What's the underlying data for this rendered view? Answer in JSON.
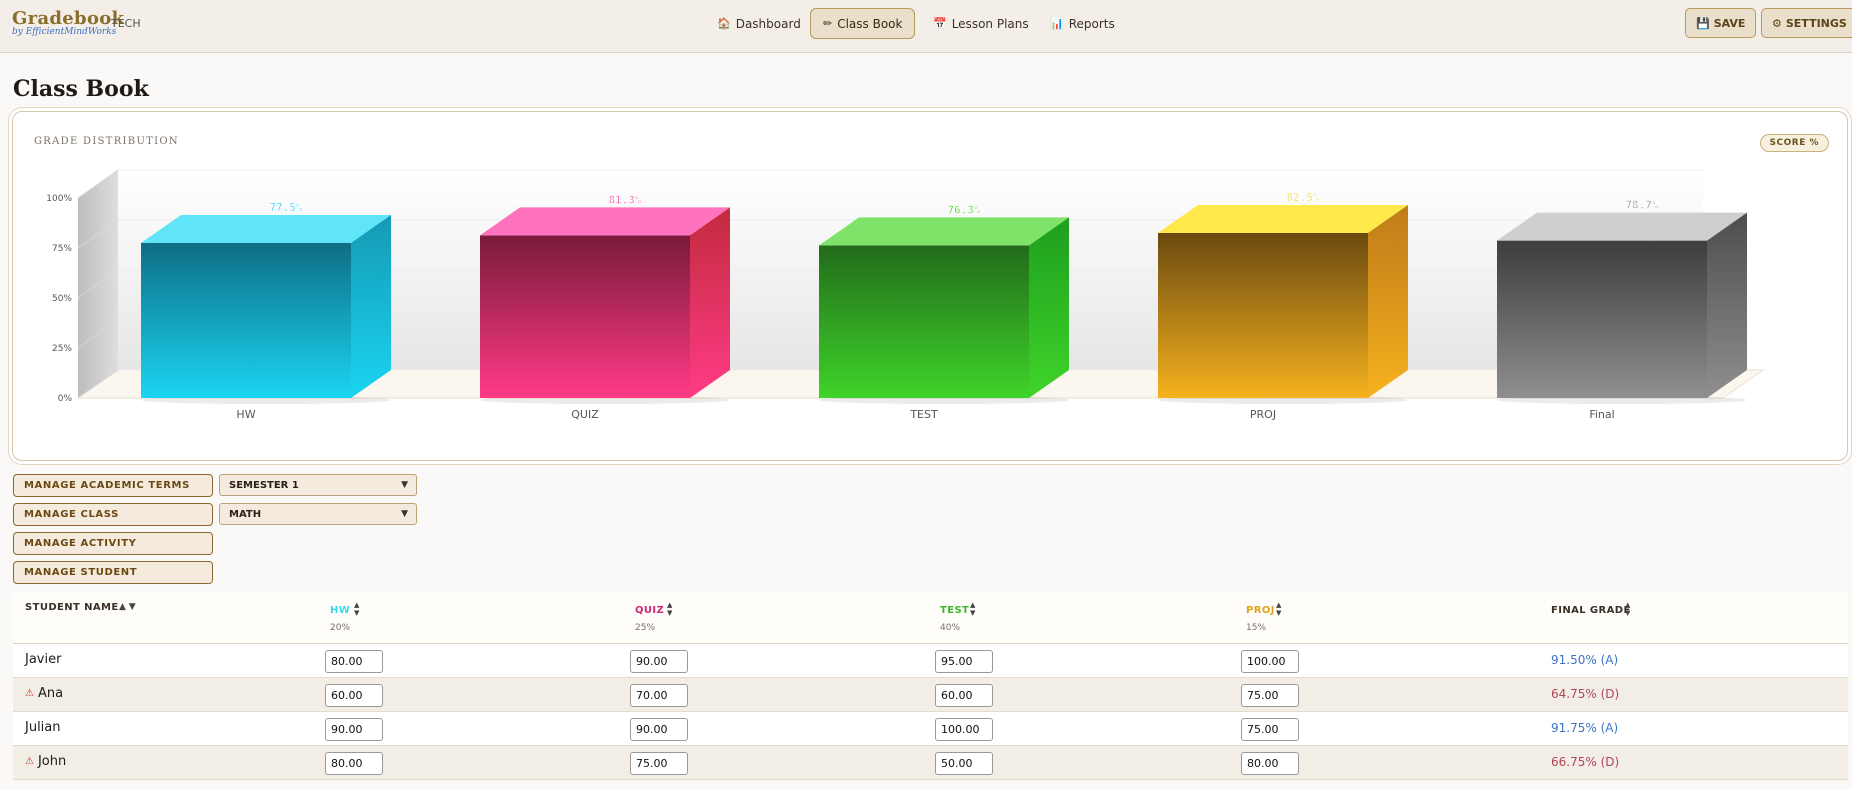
{
  "app": {
    "brand": "Gradebook",
    "brand_sub": "by EfficientMindWorks",
    "tag": "· TECH"
  },
  "nav": [
    {
      "label": "Dashboard",
      "icon": "house-icon",
      "glyph": "🏠"
    },
    {
      "label": "Class Book",
      "icon": "pencil-icon",
      "glyph": "✏"
    },
    {
      "label": "Lesson Plans",
      "icon": "calendar-icon",
      "glyph": "📅"
    },
    {
      "label": "Reports",
      "icon": "bar-chart-icon",
      "glyph": "📊"
    }
  ],
  "toolbar": {
    "save_label": "SAVE",
    "save_icon": "floppy-disk-icon",
    "settings_label": "SETTINGS",
    "settings_icon": "gear-icon"
  },
  "page": {
    "title": "Class Book"
  },
  "chart": {
    "title": "GRADE DISTRIBUTION",
    "badge": "SCORE %"
  },
  "chart_data": {
    "type": "bar",
    "title": "GRADE DISTRIBUTION",
    "categories": [
      "HW",
      "QUIZ",
      "TEST",
      "PROJ",
      "Final"
    ],
    "values": [
      77.5,
      81.3,
      76.3,
      82.5,
      78.7
    ],
    "labels": [
      "77.5%",
      "81.3%",
      "76.3%",
      "82.5%",
      "78.7%"
    ],
    "y_ticks": [
      "0%",
      "25%",
      "50%",
      "75%",
      "100%"
    ],
    "ylim": [
      0,
      100
    ],
    "colors": {
      "HW": [
        "#1ad5f2",
        "#0e6e86",
        "#5fe4f8",
        "#1599b4"
      ],
      "QUIZ": [
        "#ff3b86",
        "#7a1a3a",
        "#ff72bd",
        "#c22b3e"
      ],
      "TEST": [
        "#3fd42a",
        "#226b1a",
        "#7fe36a",
        "#1e9e1e"
      ],
      "PROJ": [
        "#f6b21e",
        "#6a4a10",
        "#ffe84a",
        "#bf7a1a"
      ],
      "Final": [
        "#8f8f8f",
        "#3d3d3d",
        "#cfcfcf",
        "#4d4d4d"
      ]
    },
    "label_colors": [
      "#3ad7f2",
      "#ff5aa8",
      "#56cf3a",
      "#f2d83a",
      "#9c9c9c"
    ]
  },
  "controls": {
    "buttons": [
      "MANAGE ACADEMIC TERMS",
      "MANAGE CLASS",
      "MANAGE ACTIVITY",
      "MANAGE STUDENT"
    ],
    "term_select": "SEMESTER 1",
    "class_select": "MATH"
  },
  "table": {
    "name_header": "STUDENT NAME",
    "columns": [
      {
        "label": "HW",
        "weight": "20%",
        "color": "#3ad7f2"
      },
      {
        "label": "QUIZ",
        "weight": "25%",
        "color": "#d0267a"
      },
      {
        "label": "TEST",
        "weight": "40%",
        "color": "#3db52a"
      },
      {
        "label": "PROJ",
        "weight": "15%",
        "color": "#e0a41a"
      }
    ],
    "final_header": "FINAL GRADE",
    "rows": [
      {
        "name": "Javier",
        "warn": false,
        "scores": [
          "80.00",
          "90.00",
          "95.00",
          "100.00"
        ],
        "final": "91.50% (A)",
        "status": "good"
      },
      {
        "name": "Ana",
        "warn": true,
        "scores": [
          "60.00",
          "70.00",
          "60.00",
          "75.00"
        ],
        "final": "64.75% (D)",
        "status": "bad"
      },
      {
        "name": "Julian",
        "warn": false,
        "scores": [
          "90.00",
          "90.00",
          "100.00",
          "75.00"
        ],
        "final": "91.75% (A)",
        "status": "good"
      },
      {
        "name": "John",
        "warn": true,
        "scores": [
          "80.00",
          "75.00",
          "50.00",
          "80.00"
        ],
        "final": "66.75% (D)",
        "status": "bad"
      }
    ]
  }
}
